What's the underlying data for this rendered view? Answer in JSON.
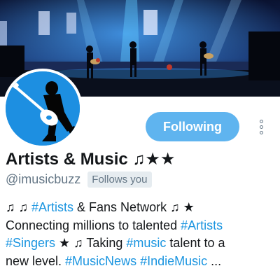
{
  "profile": {
    "name": "Artists & Music ♫★★",
    "handle": "@imusicbuzz",
    "follows_you": "Follows you",
    "follow_button_label": "Following",
    "more_icon": "more-vertical-icon",
    "accent_color": "#1b95e0",
    "button_color": "#5fb4ef"
  },
  "bio": {
    "lines": [
      [
        {
          "text": "♫ ♫ ",
          "tag": false
        },
        {
          "text": "#Artists",
          "tag": true
        },
        {
          "text": " & Fans Network ♫ ★",
          "tag": false
        }
      ],
      [
        {
          "text": "Connecting millions to talented ",
          "tag": false
        },
        {
          "text": "#Artists",
          "tag": true
        }
      ],
      [
        {
          "text": "#Singers",
          "tag": true
        },
        {
          "text": " ★ ♫ Taking ",
          "tag": false
        },
        {
          "text": "#music",
          "tag": true
        },
        {
          "text": " talent to a",
          "tag": false
        }
      ],
      [
        {
          "text": "new level. ",
          "tag": false
        },
        {
          "text": "#MusicNews",
          "tag": true
        },
        {
          "text": " ",
          "tag": false
        },
        {
          "text": "#IndieMusic",
          "tag": true
        },
        {
          "text": " ...",
          "tag": false
        }
      ]
    ]
  }
}
